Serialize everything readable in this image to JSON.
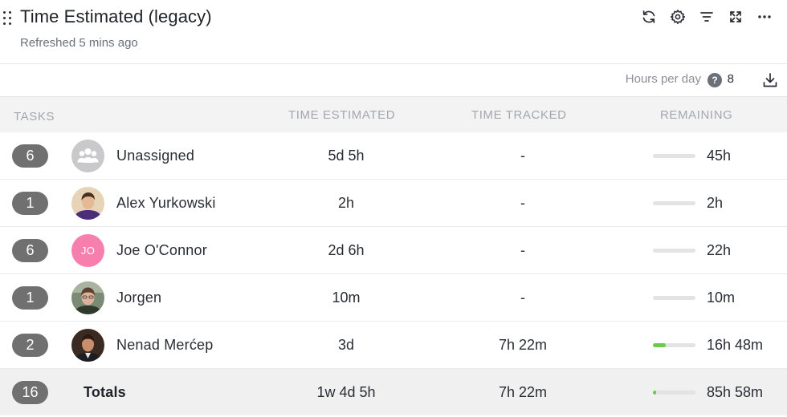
{
  "widget": {
    "title": "Time Estimated (legacy)",
    "subtitle": "Refreshed 5 mins ago"
  },
  "header_icons": [
    "refresh-icon",
    "gear-icon",
    "filter-icon",
    "expand-icon",
    "more-icon"
  ],
  "toolbar": {
    "hours_label": "Hours per day",
    "help": "?",
    "hours_value": "8"
  },
  "columns": {
    "tasks": "TASKS",
    "estimated": "TIME ESTIMATED",
    "tracked": "TIME TRACKED",
    "remaining": "REMAINING"
  },
  "rows": [
    {
      "count": "6",
      "name": "Unassigned",
      "avatar": "group-icon",
      "estimated": "5d 5h",
      "tracked": "-",
      "remaining": "45h",
      "progress": 0
    },
    {
      "count": "1",
      "name": "Alex Yurkowski",
      "avatar": "photo",
      "estimated": "2h",
      "tracked": "-",
      "remaining": "2h",
      "progress": 0
    },
    {
      "count": "6",
      "name": "Joe O'Connor",
      "avatar": "initials",
      "initials": "JO",
      "estimated": "2d 6h",
      "tracked": "-",
      "remaining": "22h",
      "progress": 0
    },
    {
      "count": "1",
      "name": "Jorgen",
      "avatar": "photo",
      "estimated": "10m",
      "tracked": "-",
      "remaining": "10m",
      "progress": 0
    },
    {
      "count": "2",
      "name": "Nenad Merćep",
      "avatar": "photo",
      "estimated": "3d",
      "tracked": "7h 22m",
      "remaining": "16h 48m",
      "progress": 0.3
    }
  ],
  "totals": {
    "count": "16",
    "label": "Totals",
    "estimated": "1w 4d 5h",
    "tracked": "7h 22m",
    "remaining": "85h 58m",
    "progress": 0.08
  },
  "colors": {
    "progress_fill": "#6bc950",
    "badge": "#707070",
    "initials_avatar": "#f77fae"
  }
}
